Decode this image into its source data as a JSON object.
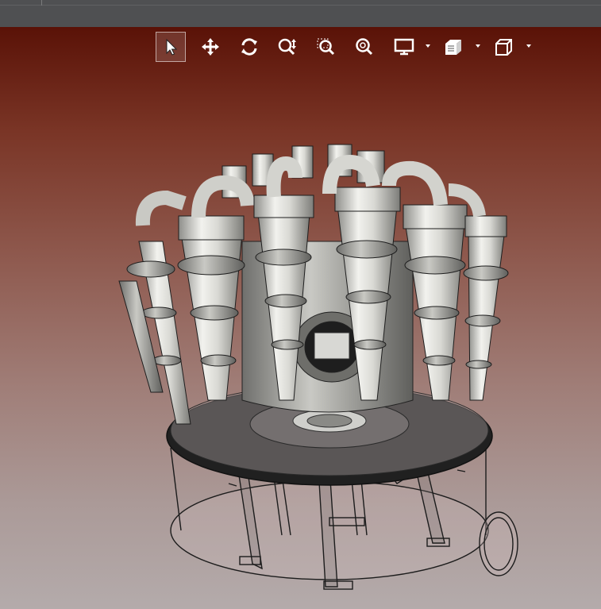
{
  "window": {
    "background_top": "#5a1207",
    "background_bottom": "#b4abab",
    "titlebar_color": "#4f5052"
  },
  "toolbar": {
    "buttons": [
      {
        "id": "select",
        "icon": "cursor-arrow-icon",
        "active": true
      },
      {
        "id": "pan",
        "icon": "move-arrows-icon",
        "active": false
      },
      {
        "id": "rotate",
        "icon": "rotate-icon",
        "active": false
      },
      {
        "id": "zoom",
        "icon": "zoom-updown-icon",
        "active": false
      },
      {
        "id": "zoom-area",
        "icon": "zoom-area-icon",
        "active": false
      },
      {
        "id": "zoom-fit",
        "icon": "zoom-fit-icon",
        "active": false
      },
      {
        "id": "display-mode",
        "icon": "monitor-icon",
        "active": false,
        "has_dropdown": true
      },
      {
        "id": "render-style",
        "icon": "shaded-cube-icon",
        "active": false,
        "has_dropdown": true
      },
      {
        "id": "view-orientation",
        "icon": "wireframe-cube-icon",
        "active": false,
        "has_dropdown": true
      }
    ]
  },
  "scene": {
    "model": "hydrocyclone-cluster-assembly-icon",
    "metal_color": "#d8d8d4",
    "outline_color": "#1c1c1c",
    "glass_color": "rgba(210,190,190,0.18)"
  }
}
